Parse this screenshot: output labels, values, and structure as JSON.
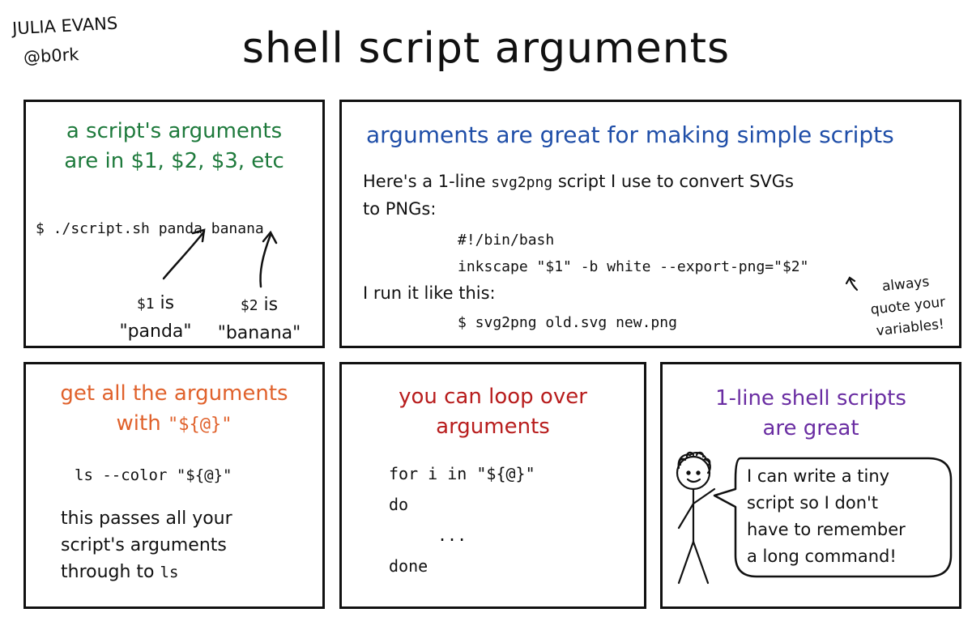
{
  "author": {
    "name": "JULIA EVANS",
    "handle": "@b0rk"
  },
  "title": "shell script arguments",
  "colors": {
    "green": "#1e7a3c",
    "blue": "#1f4ea8",
    "orange": "#e0612b",
    "red": "#b81d1d",
    "purple": "#6a2da2",
    "ink": "#111111"
  },
  "panel1": {
    "heading_line1": "a script's arguments",
    "heading_line2": "are in $1, $2, $3, etc",
    "command": "$ ./script.sh panda banana",
    "label1_var": "$1",
    "label1_is": "is",
    "label1_value": "\"panda\"",
    "label2_var": "$2",
    "label2_is": "is",
    "label2_value": "\"banana\""
  },
  "panel2": {
    "heading": "arguments are great for making simple scripts",
    "intro_a": "Here's a 1-line",
    "intro_code": "svg2png",
    "intro_b": "script I use to convert SVGs",
    "intro_line2": "to PNGs:",
    "code_line1": "#!/bin/bash",
    "code_line2": "inkscape \"$1\" -b white --export-png=\"$2\"",
    "run_text": "I run it like this:",
    "run_command": "$ svg2png old.svg new.png",
    "note_line1": "always",
    "note_line2": "quote your",
    "note_line3": "variables!"
  },
  "panel3": {
    "heading_line1": "get all the arguments",
    "heading_line2_prefix": "with",
    "heading_line2_code": "\"${@}\"",
    "code": "ls --color \"${@}\"",
    "text_line1": "this passes all your",
    "text_line2": "script's arguments",
    "text_line3_prefix": "through to",
    "text_line3_code": "ls"
  },
  "panel4": {
    "heading_line1": "you can loop over",
    "heading_line2": "arguments",
    "loop_line1": "for i in \"${@}\"",
    "loop_line2": "do",
    "loop_line3": "...",
    "loop_line4": "done"
  },
  "panel5": {
    "heading_line1": "1-line shell scripts",
    "heading_line2": "are great",
    "bubble_line1": "I can write a tiny",
    "bubble_line2": "script so I don't",
    "bubble_line3": "have to remember",
    "bubble_line4": "a long command!"
  }
}
